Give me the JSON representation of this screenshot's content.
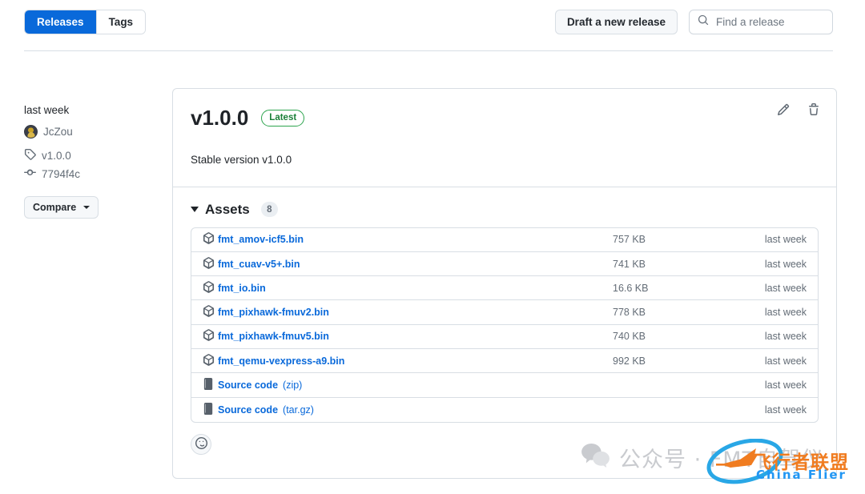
{
  "header": {
    "tabs": [
      {
        "label": "Releases",
        "active": true
      },
      {
        "label": "Tags",
        "active": false
      }
    ],
    "draft_button": "Draft a new release",
    "search_placeholder": "Find a release",
    "search_value": ""
  },
  "sidebar": {
    "date": "last week",
    "author": "JcZou",
    "tag": "v1.0.0",
    "commit": "7794f4c",
    "compare_button": "Compare"
  },
  "release": {
    "title": "v1.0.0",
    "badge": "Latest",
    "body": "Stable version v1.0.0",
    "edit_title": "Edit release",
    "delete_title": "Delete release"
  },
  "assets": {
    "label": "Assets",
    "count": "8",
    "items": [
      {
        "name": "fmt_amov-icf5.bin",
        "ext": "",
        "size": "757 KB",
        "date": "last week",
        "icon": "package-icon"
      },
      {
        "name": "fmt_cuav-v5+.bin",
        "ext": "",
        "size": "741 KB",
        "date": "last week",
        "icon": "package-icon"
      },
      {
        "name": "fmt_io.bin",
        "ext": "",
        "size": "16.6 KB",
        "date": "last week",
        "icon": "package-icon"
      },
      {
        "name": "fmt_pixhawk-fmuv2.bin",
        "ext": "",
        "size": "778 KB",
        "date": "last week",
        "icon": "package-icon"
      },
      {
        "name": "fmt_pixhawk-fmuv5.bin",
        "ext": "",
        "size": "740 KB",
        "date": "last week",
        "icon": "package-icon"
      },
      {
        "name": "fmt_qemu-vexpress-a9.bin",
        "ext": "",
        "size": "992 KB",
        "date": "last week",
        "icon": "package-icon"
      },
      {
        "name": "Source code",
        "ext": "(zip)",
        "size": "",
        "date": "last week",
        "icon": "file-zip-icon"
      },
      {
        "name": "Source code",
        "ext": "(tar.gz)",
        "size": "",
        "date": "last week",
        "icon": "file-zip-icon"
      }
    ]
  },
  "footer": {
    "reaction_title": "Add reaction"
  },
  "watermark": {
    "text": "公众号 · FMT自驾仪",
    "logo_cn": "飞行者联盟",
    "logo_en": "China Flier"
  },
  "colors": {
    "accent": "#0969da",
    "latest_green": "#1a7f37",
    "logo_orange": "#f07c20",
    "logo_blue": "#2196f3"
  }
}
